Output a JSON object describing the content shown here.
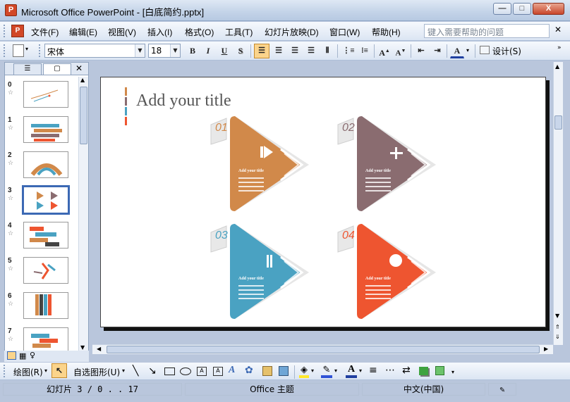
{
  "window": {
    "title": "Microsoft Office PowerPoint - [白底简约.pptx]",
    "buttons": {
      "minimize": "—",
      "maximize": "□",
      "close": "X"
    }
  },
  "menubar": {
    "items": [
      "文件(F)",
      "编辑(E)",
      "视图(V)",
      "插入(I)",
      "格式(O)",
      "工具(T)",
      "幻灯片放映(D)",
      "窗口(W)",
      "帮助(H)"
    ],
    "help_placeholder": "键入需要帮助的问题"
  },
  "format_toolbar": {
    "font": "宋体",
    "size": "18",
    "bold": "B",
    "italic": "I",
    "underline": "U",
    "shadow": "S",
    "design": "设计(S)"
  },
  "slides_pane": {
    "tabs": [
      "☰",
      "▢"
    ],
    "close": "✕",
    "thumbs": [
      {
        "num": "0"
      },
      {
        "num": "1"
      },
      {
        "num": "2"
      },
      {
        "num": "3",
        "selected": true
      },
      {
        "num": "4"
      },
      {
        "num": "5"
      },
      {
        "num": "6"
      },
      {
        "num": "7"
      }
    ]
  },
  "slide": {
    "title": "Add your title",
    "cards": [
      {
        "num": "01",
        "label": "Add your title",
        "color": "#d1894a"
      },
      {
        "num": "02",
        "label": "Add your title",
        "color": "#8a6c70"
      },
      {
        "num": "03",
        "label": "Add your title",
        "color": "#4aa2c2"
      },
      {
        "num": "04",
        "label": "Add your title",
        "color": "#ee5530"
      }
    ],
    "accent_bars": [
      "#d1894a",
      "#8a6c70",
      "#4aa2c2",
      "#ee5530"
    ]
  },
  "draw_toolbar": {
    "draw": "绘图(R)",
    "autoshapes": "自选图形(U)"
  },
  "statusbar": {
    "slide_info": "幻灯片 3 / 0 . . 17",
    "theme": "Office 主题",
    "language": "中文(中国)"
  }
}
